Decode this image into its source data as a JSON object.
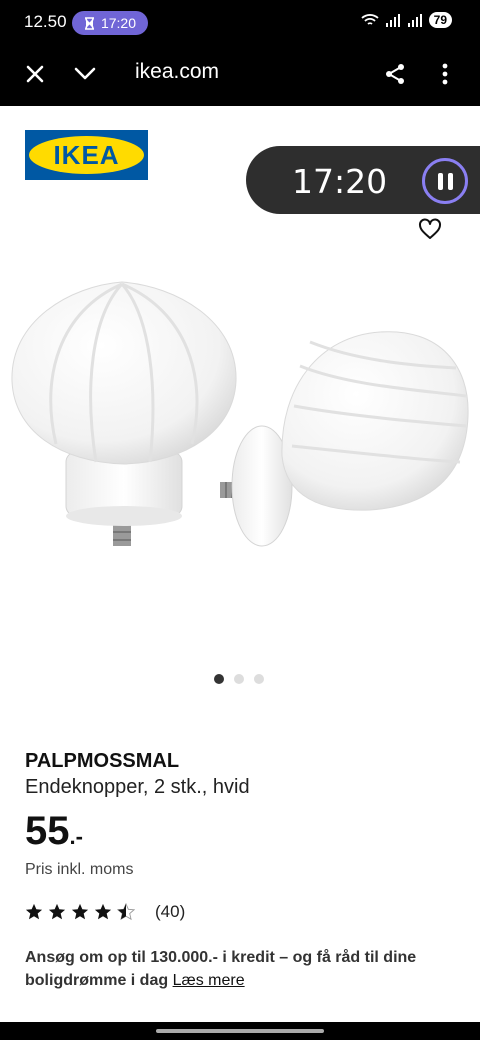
{
  "status_bar": {
    "time": "12.50",
    "timer": "17:20",
    "battery": "79"
  },
  "browser": {
    "url": "ikea.com",
    "icons": [
      "close-icon",
      "chevron-down-icon",
      "share-icon",
      "more-vertical-icon"
    ]
  },
  "logo": {
    "text": "IKEA"
  },
  "timer_overlay": {
    "time": "17:20"
  },
  "carousel": {
    "total": 3,
    "active": 1
  },
  "product": {
    "name": "PALPMOSSMAL",
    "description": "Endeknopper, 2 stk., hvid",
    "price_main": "55",
    "price_suffix": ".-",
    "vat_note": "Pris inkl. moms",
    "rating": 4.5,
    "review_count": "(40)"
  },
  "credit": {
    "text": "Ansøg om op til 130.000.- i kredit – og få råd til dine boligdrømme i dag",
    "link": "Læs mere"
  },
  "colors": {
    "ikea_blue": "#0058a3",
    "ikea_yellow": "#ffdb00",
    "timer_pill": "#7065d6",
    "overlay_bg": "#2e2e2e"
  }
}
